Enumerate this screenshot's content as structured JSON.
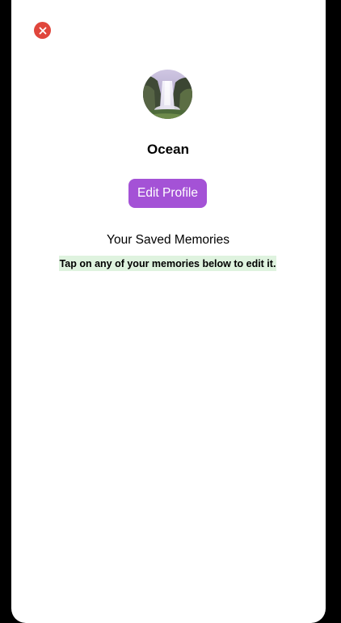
{
  "close": {
    "icon": "close-icon",
    "color": "#e0463c"
  },
  "profile": {
    "avatar_icon": "waterfall-photo",
    "username": "Ocean"
  },
  "actions": {
    "edit_profile_label": "Edit Profile",
    "accent_color": "#a452d6"
  },
  "memories": {
    "title": "Your Saved Memories",
    "hint": "Tap on any of your memories below to edit it.",
    "hint_background": "#dff3df"
  }
}
